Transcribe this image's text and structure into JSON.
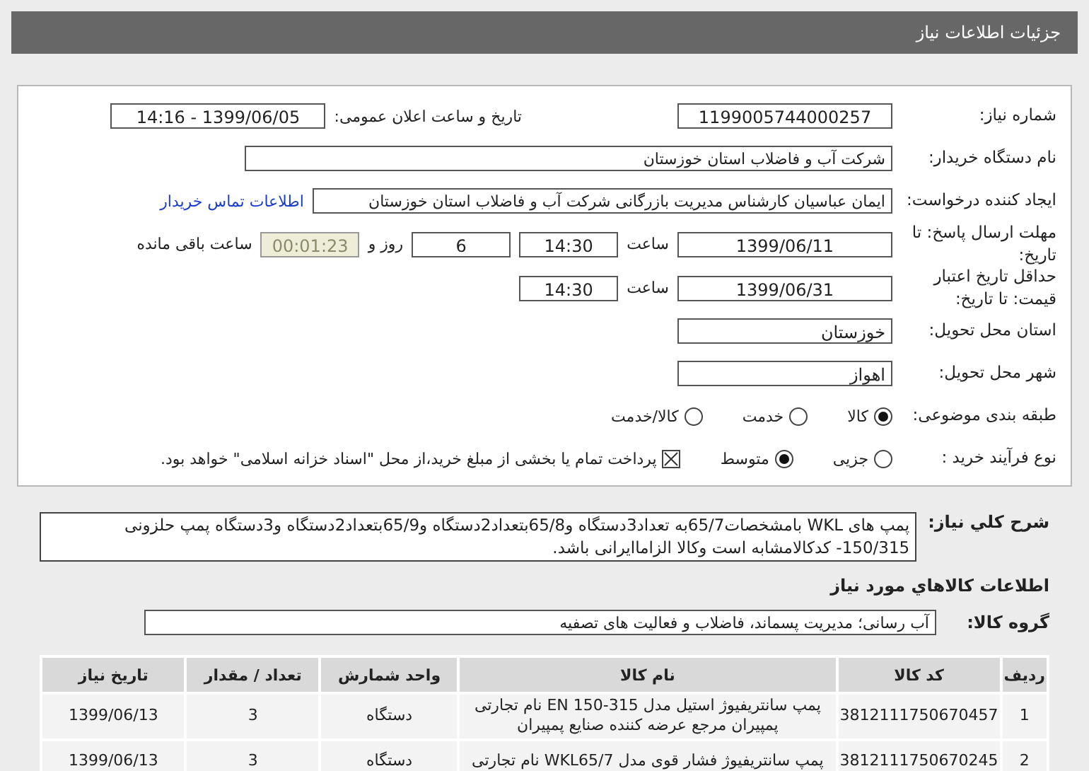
{
  "header": {
    "title": "جزئیات اطلاعات نیاز"
  },
  "details": {
    "need_number": {
      "label": "شماره نیاز:",
      "value": "1199005744000257"
    },
    "announce": {
      "label": "تاریخ و ساعت اعلان عمومی:",
      "value": "1399/06/05 - 14:16"
    },
    "buyer": {
      "label": "نام دستگاه خریدار:",
      "value": "شرکت آب و فاضلاب استان خوزستان"
    },
    "requester": {
      "label": "ایجاد کننده درخواست:",
      "value": "ایمان عباسیان کارشناس مدیریت بازرگانی شرکت آب و فاضلاب استان خوزستان",
      "link": "اطلاعات تماس خریدار"
    },
    "reply_deadline": {
      "label": "مهلت ارسال پاسخ: تا تاریخ:",
      "date": "1399/06/11",
      "time_label": "ساعت",
      "time": "14:30",
      "days": "6",
      "days_label": "روز و",
      "remaining": "00:01:23",
      "remaining_label": "ساعت باقی مانده"
    },
    "price_validity": {
      "label": "حداقل تاریخ اعتبار قیمت: تا تاریخ:",
      "date": "1399/06/31",
      "time_label": "ساعت",
      "time": "14:30"
    },
    "province": {
      "label": "استان محل تحویل:",
      "value": "خوزستان"
    },
    "city": {
      "label": "شهر محل تحویل:",
      "value": "اهواز"
    },
    "category": {
      "label": "طبقه بندی موضوعی:",
      "options": [
        {
          "label": "کالا",
          "selected": true
        },
        {
          "label": "خدمت",
          "selected": false
        },
        {
          "label": "کالا/خدمت",
          "selected": false
        }
      ]
    },
    "process": {
      "label": "نوع فرآیند خرید :",
      "options": [
        {
          "label": "جزیی",
          "selected": false
        },
        {
          "label": "متوسط",
          "selected": true
        }
      ],
      "treasury": {
        "label": "پرداخت تمام یا بخشی از مبلغ خرید،از محل \"اسناد خزانه اسلامی\" خواهد بود.",
        "checked": true
      }
    }
  },
  "description": {
    "label": "شرح كلي نياز:",
    "text": "پمپ های WKL بامشخصات65/7به تعداد3دستگاه و65/8بتعداد2دستگاه و65/9بتعداد2دستگاه و3دستگاه پمپ حلزونی 150/315- کدکالامشابه است وکالا الزاماایرانی باشد."
  },
  "goods_title": "اطلاعات كالاهاي مورد نياز",
  "goods_group": {
    "label": "گروه کالا:",
    "value": "آب رسانی؛ مدیریت پسماند، فاضلاب و فعالیت های تصفیه"
  },
  "table": {
    "columns": [
      "ردیف",
      "کد کالا",
      "نام کالا",
      "واحد شمارش",
      "تعداد / مقدار",
      "تاریخ نیاز"
    ],
    "rows": [
      [
        "1",
        "3812111750670457",
        "پمپ سانتریفیوژ استیل مدل EN 150-315 نام تجارتی پمپیران مرجع عرضه کننده صنایع پمپیران",
        "دستگاه",
        "3",
        "1399/06/13"
      ],
      [
        "2",
        "3812111750670245",
        "پمپ سانتریفیوژ فشار قوی مدل WKL65/7 نام تجارتی",
        "دستگاه",
        "3",
        "1399/06/13"
      ]
    ]
  }
}
